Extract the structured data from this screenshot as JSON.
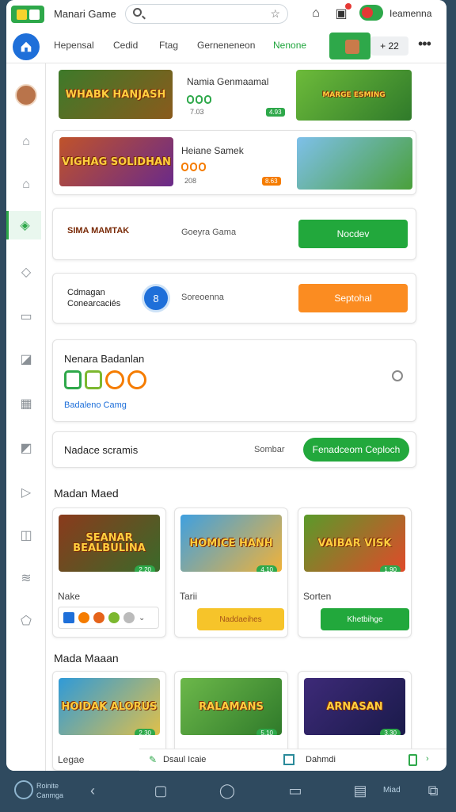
{
  "topbar": {
    "app_title": "Manari Game",
    "user_name": "Ieamenna"
  },
  "tabs": {
    "items": [
      "Hepensal",
      "Cedid",
      "Ftag",
      "Gerneneneon",
      "Nenone"
    ],
    "active_index": 4,
    "count_label": "+ 22"
  },
  "sidebar": {
    "icons": [
      "avatar",
      "home-icon",
      "home-alt-icon",
      "tag-active-icon",
      "tag-icon",
      "bag-icon",
      "edit-icon",
      "grid-icon",
      "note-icon",
      "play-icon",
      "chart-icon",
      "wifi-icon",
      "shape-icon"
    ]
  },
  "featured": [
    {
      "thumb_text": "WHABK HANJASH",
      "title": "Namia Genmaamal",
      "small": "7.03",
      "tag": "4.93",
      "side_text": "MARGE ESMING",
      "colors": [
        "#2ea84a",
        "#2ea84a",
        "#7cb82f"
      ]
    },
    {
      "thumb_text": "VIGHAG SOLIDHAN",
      "title": "Heiane Samek",
      "small": "208",
      "tag": "8.63",
      "colors": [
        "#f57c00",
        "#f57c00",
        "#f57c00"
      ]
    }
  ],
  "promo": {
    "logo_text": "SIMA MAMTAK",
    "label": "Goeyra Gama",
    "button": "Nocdev"
  },
  "support": {
    "line1": "Cdmagan",
    "line2": "Conearcaciés",
    "circle_label": "8",
    "status": "Soreoenna",
    "button": "Septohal"
  },
  "progress_card": {
    "title": "Nenara Badanlan",
    "link": "Badaleno Camg"
  },
  "search_row": {
    "label": "Nadace scramis",
    "secondary": "Sombar",
    "button": "Fenadceom Ceploch"
  },
  "section1": {
    "title": "Madan Maed",
    "cards": [
      {
        "thumb_text": "SEANAR BEALBULINA",
        "name": "Nake",
        "tag": "2.20",
        "bg": "#8a3a1c"
      },
      {
        "thumb_text": "HOMICE HANH",
        "name": "Tarii",
        "tag": "4.10",
        "bg": "#3fa0e0",
        "button": "Naddaeihes"
      },
      {
        "thumb_text": "VAIBAR VISK",
        "name": "Sorten",
        "tag": "1.90",
        "bg": "#5a9a2a",
        "button": "Khetbihge"
      }
    ]
  },
  "section2": {
    "title": "Mada Maaan",
    "cards": [
      {
        "thumb_text": "HOIDAK ALORUS",
        "name": "Legae",
        "tag": "2.30",
        "bg": "#2f9ad8"
      },
      {
        "thumb_text": "RALAMANS",
        "name": "",
        "tag": "5.10",
        "bg": "#6cb84a"
      },
      {
        "thumb_text": "ARNASAN",
        "name": "",
        "tag": "3.30",
        "bg": "#3d2a78"
      }
    ]
  },
  "bottom_strip": {
    "left": "Dsaul Icaie",
    "right": "Dahmdi"
  },
  "navbar": {
    "brand_line1": "Roinite",
    "brand_line2": "Canmga",
    "right_label": "Miad"
  },
  "colors": {
    "accent_green": "#2ea84a",
    "accent_orange": "#fb8c21",
    "accent_blue": "#1e6fd9"
  }
}
